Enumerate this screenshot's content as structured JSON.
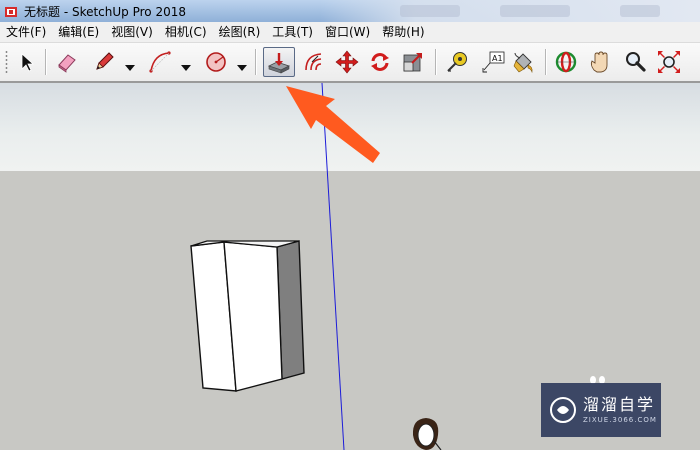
{
  "window": {
    "title": "无标题 - SketchUp Pro 2018"
  },
  "menu": {
    "items": [
      {
        "label": "文件(F)"
      },
      {
        "label": "编辑(E)"
      },
      {
        "label": "视图(V)"
      },
      {
        "label": "相机(C)"
      },
      {
        "label": "绘图(R)"
      },
      {
        "label": "工具(T)"
      },
      {
        "label": "窗口(W)"
      },
      {
        "label": "帮助(H)"
      }
    ]
  },
  "toolbar": {
    "tools": [
      {
        "name": "select",
        "icon": "arrow-cursor-icon"
      },
      {
        "name": "eraser",
        "icon": "eraser-icon"
      },
      {
        "name": "line",
        "icon": "pencil-icon",
        "has_dropdown": true
      },
      {
        "name": "arc",
        "icon": "arc-icon",
        "has_dropdown": true
      },
      {
        "name": "shapes",
        "icon": "circle-icon",
        "has_dropdown": true
      },
      {
        "name": "push-pull",
        "icon": "push-pull-icon",
        "active": true
      },
      {
        "name": "offset",
        "icon": "offset-icon"
      },
      {
        "name": "move",
        "icon": "move-icon"
      },
      {
        "name": "rotate",
        "icon": "rotate-icon"
      },
      {
        "name": "scale",
        "icon": "scale-icon"
      },
      {
        "name": "tape-measure",
        "icon": "tape-measure-icon"
      },
      {
        "name": "text",
        "icon": "text-label-icon",
        "label": "A1"
      },
      {
        "name": "paint-bucket",
        "icon": "paint-bucket-icon"
      },
      {
        "name": "orbit",
        "icon": "orbit-icon"
      },
      {
        "name": "pan",
        "icon": "hand-icon"
      },
      {
        "name": "zoom",
        "icon": "magnifier-icon"
      },
      {
        "name": "zoom-extents",
        "icon": "zoom-extents-icon"
      }
    ]
  },
  "colors": {
    "annotation_arrow": "#ff5a1f",
    "axis_blue": "#1c1cd8",
    "sky_top": "#d7dde2",
    "ground": "#c8c8c4",
    "watermark_bg": "#283458"
  },
  "watermark": {
    "title": "溜溜自学",
    "subtitle": "ZIXUE.3066.COM"
  }
}
